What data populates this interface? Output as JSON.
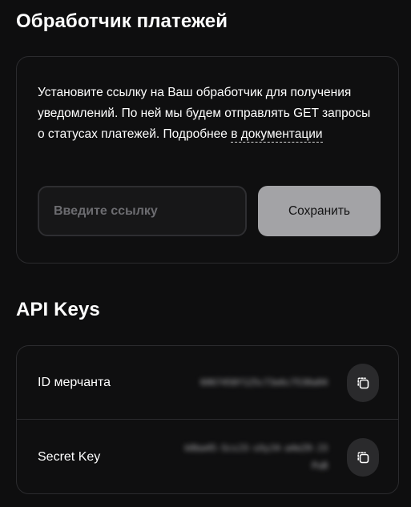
{
  "webhook": {
    "title": "Обработчик платежей",
    "description": "Установите ссылку на Ваш обработчик для получения уведомлений. По ней мы будем отправлять GET запросы о статусах платежей. Подробнее ",
    "doc_link": "в документации",
    "input": {
      "placeholder": "Введите ссылку",
      "value": ""
    },
    "save_label": "Сохранить"
  },
  "api_keys": {
    "title": "API Keys",
    "rows": [
      {
        "label": "ID мерчанта",
        "value": "6067458f125c73e6c7530a04",
        "icon": "copy-icon"
      },
      {
        "label": "Secret Key",
        "value": "k0ba45-ScsJ3-sXyJ4-a4e29-J3PuB",
        "icon": "copy-icon"
      }
    ]
  },
  "colors": {
    "background": "#0e0e0f",
    "card_border": "#2b2b2e",
    "save_button": "#a3a3a6",
    "icon_button": "#2a2a2c"
  }
}
